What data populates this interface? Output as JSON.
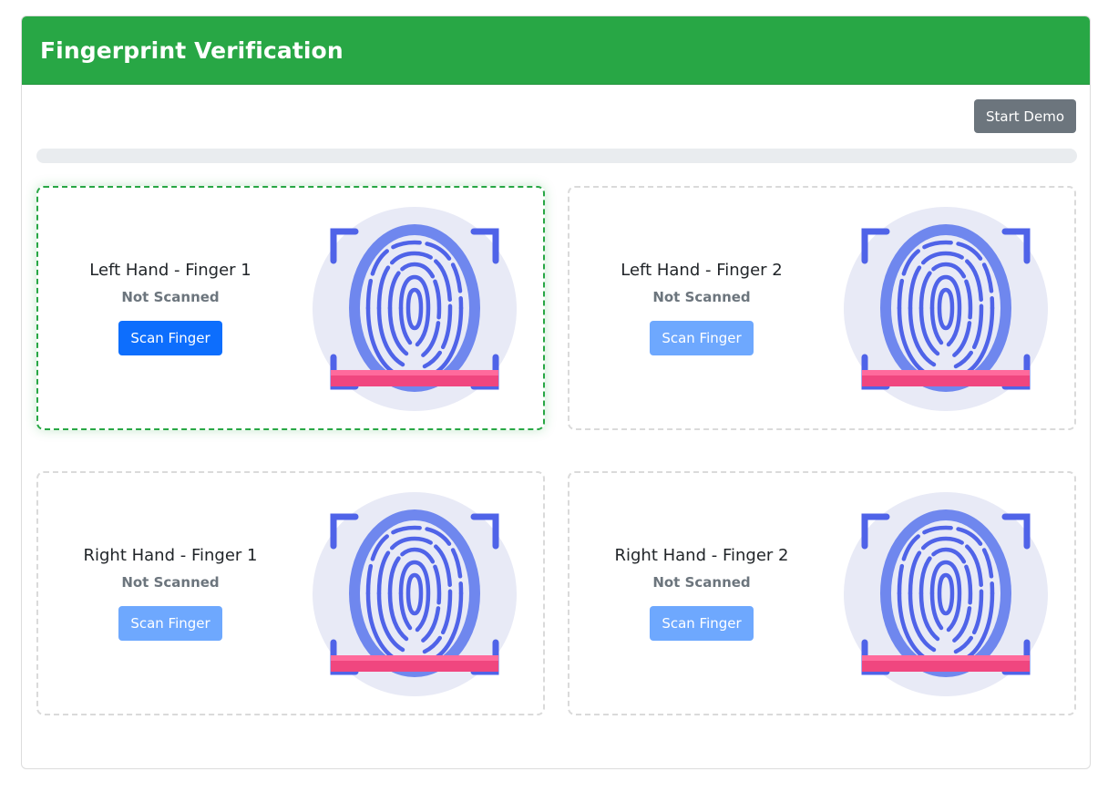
{
  "header": {
    "title": "Fingerprint Verification"
  },
  "toolbar": {
    "start_label": "Start Demo"
  },
  "progress": {
    "value_percent": 0
  },
  "slots": [
    {
      "title": "Left Hand - Finger 1",
      "status": "Not Scanned",
      "button_label": "Scan Finger",
      "active": true,
      "enabled": true
    },
    {
      "title": "Left Hand - Finger 2",
      "status": "Not Scanned",
      "button_label": "Scan Finger",
      "active": false,
      "enabled": false
    },
    {
      "title": "Right Hand - Finger 1",
      "status": "Not Scanned",
      "button_label": "Scan Finger",
      "active": false,
      "enabled": false
    },
    {
      "title": "Right Hand - Finger 2",
      "status": "Not Scanned",
      "button_label": "Scan Finger",
      "active": false,
      "enabled": false
    }
  ],
  "icons": {
    "fingerprint": "fingerprint-scanner-icon"
  },
  "colors": {
    "header_bg": "#28a745",
    "active_border": "#28a745",
    "primary_button": "#0d6efd",
    "disabled_button": "#6ea8fe",
    "secondary_button": "#6c757d",
    "scan_bar": "#f0467f"
  }
}
